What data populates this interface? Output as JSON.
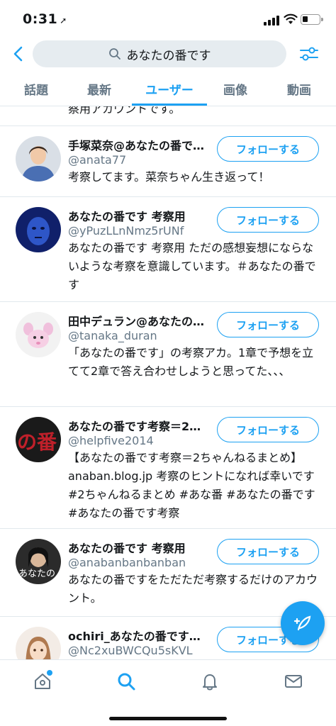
{
  "status_bar": {
    "time": "0:31",
    "location_arrow": "location-arrow-icon"
  },
  "search": {
    "query": "あなたの番です"
  },
  "tabs": [
    {
      "label": "話題",
      "active": false
    },
    {
      "label": "最新",
      "active": false
    },
    {
      "label": "ユーザー",
      "active": true
    },
    {
      "label": "画像",
      "active": false
    },
    {
      "label": "動画",
      "active": false
    }
  ],
  "cut_text": "察用アカウントです。",
  "users": [
    {
      "name": "手塚菜奈@あなたの番で…",
      "handle": "@anata77",
      "bio": "考察してます。菜奈ちゃん生き返って！",
      "follow_label": "フォローする"
    },
    {
      "name": "あなたの番です 考察用",
      "handle": "@yPuzLLnNmz5rUNf",
      "bio": "あなたの番です 考察用 ただの感想妄想にならないような考察を意識しています。＃あなたの番です",
      "follow_label": "フォローする"
    },
    {
      "name": "田中デュラン@あなたの…",
      "handle": "@tanaka_duran",
      "bio": "「あなたの番です」の考察アカ。1章で予想を立てて2章で答え合わせしようと思ってた、、、",
      "follow_label": "フォローする"
    },
    {
      "name": "あなたの番です考察＝2…",
      "handle": "@helpfive2014",
      "bio": "【あなたの番です考察＝2ちゃんねるまとめ】anaban.blog.jp 考察のヒントになれば幸いです #2ちゃんねるまとめ #あな番 #あなたの番です #あなたの番です考察",
      "follow_label": "フォローする",
      "avatar_text": "の番"
    },
    {
      "name": "あなたの番です 考察用",
      "handle": "@anabanbanbanban",
      "bio": "あなたの番ですをただただ考察するだけのアカウント。",
      "follow_label": "フォローする",
      "avatar_text": "あなたの"
    },
    {
      "name": "ochiri_あなたの番です…",
      "handle": "@Nc2xuBWCQu5sKVL",
      "bio": "",
      "follow_label": "フォローする"
    }
  ],
  "colors": {
    "accent": "#1da1f2",
    "secondary_text": "#657786",
    "divider": "#e1e8ed"
  },
  "bottom_nav": [
    "home-icon",
    "search-icon",
    "bell-icon",
    "mail-icon"
  ]
}
